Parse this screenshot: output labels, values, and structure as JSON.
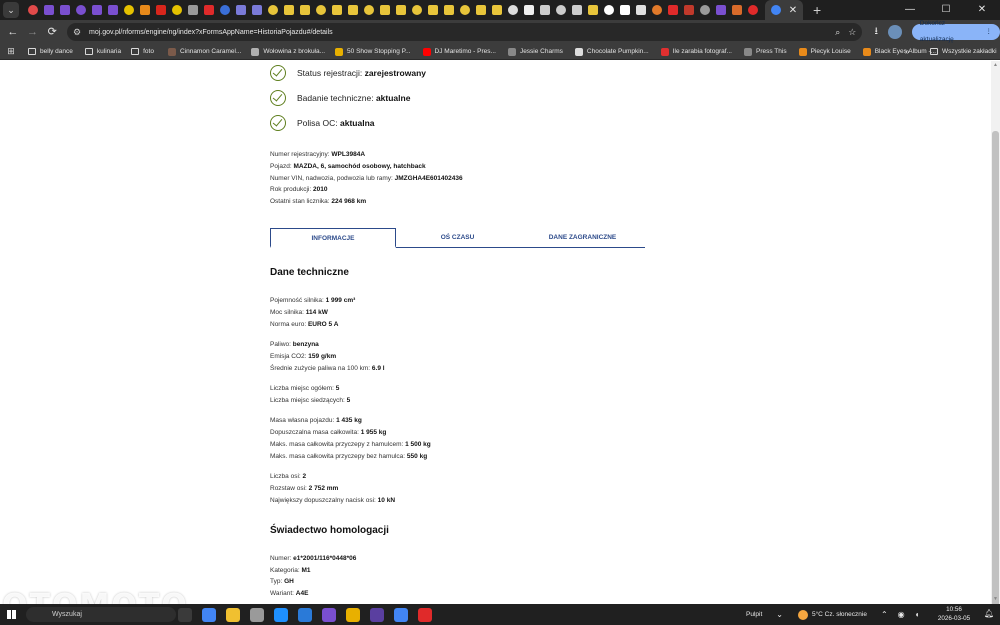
{
  "browser": {
    "active_tab_close": "✕",
    "new_tab": "+",
    "window_controls": [
      "—",
      "☐",
      "✕"
    ],
    "url": "moj.gov.pl/nforms/engine/ng/index?xFormsAppName=HistoriaPojazdu#/details",
    "update_button": "Dokończ aktualizację",
    "update_menu": "⋮",
    "tab_favicon_colors": [
      "#e24a4a",
      "#7a4fd0",
      "#7a4fd0",
      "#7a4fd0",
      "#7a4fd0",
      "#7a4fd0",
      "#e5c200",
      "#e88a1a",
      "#d9261c",
      "#e5c200",
      "#9a9a9a",
      "#e02a2a",
      "#3a6fd8",
      "#7a7ad8",
      "#7a7ad8",
      "#e8c53a",
      "#e8c53a",
      "#e8c53a",
      "#e8c53a",
      "#e8c53a",
      "#e8c53a",
      "#e8c53a",
      "#e8c53a",
      "#e8c53a",
      "#e8c53a",
      "#e8c53a",
      "#e8c53a",
      "#e8c53a",
      "#e8c53a",
      "#e8c53a",
      "#dddddd",
      "#f0f0f0",
      "#cccccc",
      "#cccccc",
      "#cccccc",
      "#e8c53a",
      "#ffffff",
      "#ffffff",
      "#e0e0e0",
      "#e27a2a",
      "#e02a2a",
      "#c0392b",
      "#9a9a9a",
      "#7a4fd0",
      "#d86a2a",
      "#e02a2a"
    ]
  },
  "bookmarks": [
    {
      "label": "belly dance",
      "icon": "folder"
    },
    {
      "label": "kulinaria",
      "icon": "folder"
    },
    {
      "label": "foto",
      "icon": "folder"
    },
    {
      "label": "Cinnamon Caramel...",
      "icon": "#7b5a4a"
    },
    {
      "label": "Wołowina z brokuła...",
      "icon": "#b0b0b0"
    },
    {
      "label": "50 Show Stopping P...",
      "icon": "#e8b000"
    },
    {
      "label": "DJ Maretimo - Pres...",
      "icon": "#ff0000"
    },
    {
      "label": "Jessie Charms",
      "icon": "#888888"
    },
    {
      "label": "Chocolate Pumpkin...",
      "icon": "#dddddd"
    },
    {
      "label": "Ile zarabia fotograf...",
      "icon": "#e03030"
    },
    {
      "label": "Press This",
      "icon": "#888888"
    },
    {
      "label": "Piecyk Louise",
      "icon": "#e88a1a"
    },
    {
      "label": "Black Eyes Album -...",
      "icon": "#e88a1a"
    }
  ],
  "bookmarks_more": "»",
  "bookmarks_all": "Wszystkie zakładki",
  "status": [
    {
      "label": "Status rejestracji:",
      "value": "zarejestrowany"
    },
    {
      "label": "Badanie techniczne:",
      "value": "aktualne"
    },
    {
      "label": "Polisa OC:",
      "value": "aktualna"
    }
  ],
  "vehicle": {
    "reg_label": "Numer rejestracyjny:",
    "reg_value": "WPL3984A",
    "veh_label": "Pojazd:",
    "veh_value": "MAZDA, 6, samochód osobowy, hatchback",
    "vin_label": "Numer VIN, nadwozia, podwozia lub ramy:",
    "vin_value": "JMZGHA4E601402436",
    "year_label": "Rok produkcji:",
    "year_value": "2010",
    "odo_label": "Ostatni stan licznika:",
    "odo_value": "224 968 km"
  },
  "page_tabs": [
    "INFORMACJE",
    "OŚ CZASU",
    "DANE ZAGRANICZNE"
  ],
  "tech": {
    "title": "Dane techniczne",
    "rows": [
      {
        "label": "Pojemność silnika:",
        "value": "1 999 cm³"
      },
      {
        "label": "Moc silnika:",
        "value": "114 kW"
      },
      {
        "label": "Norma euro:",
        "value": "EURO 5 A"
      },
      {
        "label": "Paliwo:",
        "value": "benzyna"
      },
      {
        "label": "Emisja CO2:",
        "value": "159 g/km"
      },
      {
        "label": "Średnie zużycie paliwa na 100 km:",
        "value": "6.9 l"
      },
      {
        "label": "Liczba miejsc ogółem:",
        "value": "5"
      },
      {
        "label": "Liczba miejsc siedzących:",
        "value": "5"
      },
      {
        "label": "Masa własna pojazdu:",
        "value": "1 435 kg"
      },
      {
        "label": "Dopuszczalna masa całkowita:",
        "value": "1 955 kg"
      },
      {
        "label": "Maks. masa całkowita przyczepy z hamulcem:",
        "value": "1 500 kg"
      },
      {
        "label": "Maks. masa całkowita przyczepy bez hamulca:",
        "value": "550 kg"
      },
      {
        "label": "Liczba osi:",
        "value": "2"
      },
      {
        "label": "Rozstaw osi:",
        "value": "2 752 mm"
      },
      {
        "label": "Największy dopuszczalny nacisk osi:",
        "value": "10 kN"
      }
    ]
  },
  "homologation": {
    "title": "Świadectwo homologacji",
    "rows": [
      {
        "label": "Numer:",
        "value": "e1*2001/116*0448*06"
      },
      {
        "label": "Kategoria:",
        "value": "M1"
      },
      {
        "label": "Typ:",
        "value": "GH"
      },
      {
        "label": "Wariant:",
        "value": "A4E"
      }
    ]
  },
  "watermark": "OTOMOTO",
  "taskbar": {
    "search_placeholder": "Wyszukaj",
    "app_colors": [
      "#3a3a3a",
      "#4285f4",
      "#f0c030",
      "#9a9a9a",
      "#1e90ff",
      "#2a7ad8",
      "#7a4fd0",
      "#e8b000",
      "#5a3fa0",
      "#4285f4",
      "#e02a2a"
    ],
    "tray_label": "Pulpit",
    "weather": "5°C  Cz. słonecznie",
    "time": "10:56",
    "date": "2026-03-05"
  }
}
